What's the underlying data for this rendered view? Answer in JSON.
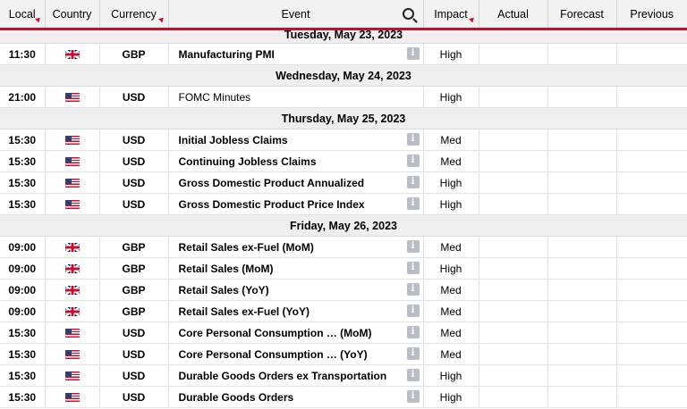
{
  "headers": {
    "local": "Local",
    "country": "Country",
    "currency": "Currency",
    "event": "Event",
    "impact": "Impact",
    "actual": "Actual",
    "forecast": "Forecast",
    "previous": "Previous"
  },
  "colors": {
    "accent": "#c8102e",
    "header_bg": "#f2f2f2",
    "date_bg": "#efefef",
    "info_icon": "#b8bec6"
  },
  "days": [
    {
      "date": "Tuesday, May 23, 2023",
      "events": [
        {
          "time": "11:30",
          "country": "gb-flag-icon",
          "currency": "GBP",
          "event": "Manufacturing PMI",
          "info": "i",
          "impact": "High",
          "actual": "",
          "forecast": "",
          "previous": ""
        }
      ]
    },
    {
      "date": "Wednesday, May 24, 2023",
      "events": [
        {
          "time": "21:00",
          "country": "us-flag-icon",
          "currency": "USD",
          "event": "FOMC Minutes",
          "impact": "High",
          "actual": "",
          "forecast": "",
          "previous": ""
        }
      ]
    },
    {
      "date": "Thursday, May 25, 2023",
      "events": [
        {
          "time": "15:30",
          "country": "us-flag-icon",
          "currency": "USD",
          "event": "Initial Jobless Claims",
          "info": "i",
          "impact": "Med",
          "actual": "",
          "forecast": "",
          "previous": ""
        },
        {
          "time": "15:30",
          "country": "us-flag-icon",
          "currency": "USD",
          "event": "Continuing Jobless Claims",
          "info": "i",
          "impact": "Med",
          "actual": "",
          "forecast": "",
          "previous": ""
        },
        {
          "time": "15:30",
          "country": "us-flag-icon",
          "currency": "USD",
          "event": "Gross Domestic Product Annualized",
          "info": "i",
          "impact": "High",
          "actual": "",
          "forecast": "",
          "previous": ""
        },
        {
          "time": "15:30",
          "country": "us-flag-icon",
          "currency": "USD",
          "event": "Gross Domestic Product Price Index",
          "info": "i",
          "impact": "High",
          "actual": "",
          "forecast": "",
          "previous": ""
        }
      ]
    },
    {
      "date": "Friday, May 26, 2023",
      "events": [
        {
          "time": "09:00",
          "country": "gb-flag-icon",
          "currency": "GBP",
          "event": "Retail Sales ex-Fuel (MoM)",
          "info": "i",
          "impact": "Med",
          "actual": "",
          "forecast": "",
          "previous": ""
        },
        {
          "time": "09:00",
          "country": "gb-flag-icon",
          "currency": "GBP",
          "event": "Retail Sales (MoM)",
          "info": "i",
          "impact": "High",
          "actual": "",
          "forecast": "",
          "previous": ""
        },
        {
          "time": "09:00",
          "country": "gb-flag-icon",
          "currency": "GBP",
          "event": "Retail Sales (YoY)",
          "info": "i",
          "impact": "Med",
          "actual": "",
          "forecast": "",
          "previous": ""
        },
        {
          "time": "09:00",
          "country": "gb-flag-icon",
          "currency": "GBP",
          "event": "Retail Sales ex-Fuel (YoY)",
          "info": "i",
          "impact": "Med",
          "actual": "",
          "forecast": "",
          "previous": ""
        },
        {
          "time": "15:30",
          "country": "us-flag-icon",
          "currency": "USD",
          "event": "Core Personal Consumption … (MoM)",
          "info": "i",
          "impact": "Med",
          "actual": "",
          "forecast": "",
          "previous": ""
        },
        {
          "time": "15:30",
          "country": "us-flag-icon",
          "currency": "USD",
          "event": "Core Personal Consumption … (YoY)",
          "info": "i",
          "impact": "Med",
          "actual": "",
          "forecast": "",
          "previous": ""
        },
        {
          "time": "15:30",
          "country": "us-flag-icon",
          "currency": "USD",
          "event": "Durable Goods Orders ex Transportation",
          "info": "i",
          "impact": "High",
          "actual": "",
          "forecast": "",
          "previous": ""
        },
        {
          "time": "15:30",
          "country": "us-flag-icon",
          "currency": "USD",
          "event": "Durable Goods Orders",
          "info": "i",
          "impact": "High",
          "actual": "",
          "forecast": "",
          "previous": ""
        }
      ]
    }
  ]
}
